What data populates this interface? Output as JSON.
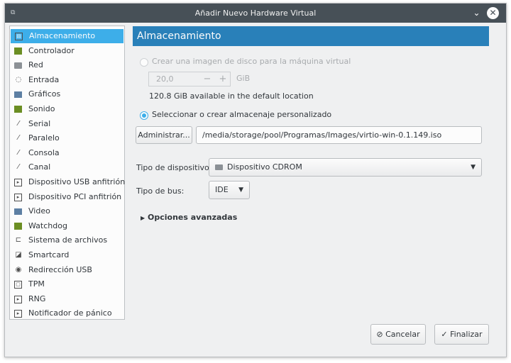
{
  "window": {
    "title": "Añadir Nuevo Hardware Virtual",
    "app_icon_text": "&#x29C9;",
    "minimize_glyph": "⌄",
    "close_glyph": "✕"
  },
  "sidebar": {
    "items": [
      {
        "label": "Almacenamiento",
        "icon": "storage-icon",
        "glyph": "▤"
      },
      {
        "label": "Controlador",
        "icon": "controller-icon",
        "glyph": "▦"
      },
      {
        "label": "Red",
        "icon": "network-icon",
        "glyph": "▬"
      },
      {
        "label": "Entrada",
        "icon": "mouse-icon",
        "glyph": "◌"
      },
      {
        "label": "Gráficos",
        "icon": "display-icon",
        "glyph": "▬"
      },
      {
        "label": "Sonido",
        "icon": "sound-icon",
        "glyph": "▬"
      },
      {
        "label": "Serial",
        "icon": "serial-icon",
        "glyph": "⁄"
      },
      {
        "label": "Paralelo",
        "icon": "parallel-icon",
        "glyph": "⁄"
      },
      {
        "label": "Consola",
        "icon": "console-icon",
        "glyph": "⁄"
      },
      {
        "label": "Canal",
        "icon": "channel-icon",
        "glyph": "⁄"
      },
      {
        "label": "Dispositivo USB anfitrión",
        "icon": "usb-host-icon",
        "glyph": "▸"
      },
      {
        "label": "Dispositivo PCI anfitrión",
        "icon": "pci-host-icon",
        "glyph": "▸"
      },
      {
        "label": "Video",
        "icon": "video-icon",
        "glyph": "▬"
      },
      {
        "label": "Watchdog",
        "icon": "watchdog-icon",
        "glyph": "▦"
      },
      {
        "label": "Sistema de archivos",
        "icon": "folder-icon",
        "glyph": "⊏"
      },
      {
        "label": "Smartcard",
        "icon": "smartcard-icon",
        "glyph": "◪"
      },
      {
        "label": "Redirección USB",
        "icon": "usb-redirect-icon",
        "glyph": "◉"
      },
      {
        "label": "TPM",
        "icon": "tpm-icon",
        "glyph": "▢"
      },
      {
        "label": "RNG",
        "icon": "rng-icon",
        "glyph": "▸"
      },
      {
        "label": "Notificador de pánico",
        "icon": "panic-notifier-icon",
        "glyph": "▸"
      }
    ],
    "selected_index": 0
  },
  "main": {
    "header": "Almacenamiento",
    "create_image_label": "Crear una imagen de disco para la máquina virtual",
    "disk_size_value": "20,0",
    "disk_size_unit": "GiB",
    "available_text": "120.8 GiB available in the default location",
    "custom_storage_label": "Seleccionar o crear almacenaje personalizado",
    "manage_button": "Administrar...",
    "storage_path": "/media/storage/pool/Programas/Images/virtio-win-0.1.149.iso",
    "device_type_label": "Tipo de dispositivo:",
    "device_type_value": "Dispositivo CDROM",
    "bus_type_label": "Tipo de bus:",
    "bus_type_value": "IDE",
    "advanced_options": "Opciones avanzadas",
    "selected_radio": "custom"
  },
  "footer": {
    "cancel_button": "Cancelar",
    "finish_button": "Finalizar"
  },
  "colors": {
    "titlebar": "#475057",
    "accent": "#3daee9",
    "header": "#2980b9",
    "background": "#eff0f1"
  }
}
